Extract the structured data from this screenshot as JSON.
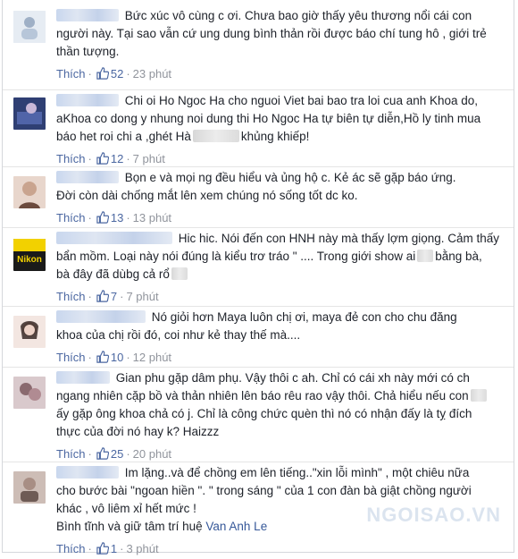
{
  "comments": [
    {
      "text_lines": [
        "Bức xúc vô cùng c ơi. Chưa bao giờ thấy yêu thương nổi cái con",
        "người này. Tại sao vẫn cứ ung dung bình thản rồi được báo chí tung hô , giới trẻ",
        "thần tượng."
      ],
      "like_label": "Thích",
      "likes": "52",
      "time": "23 phút",
      "avatar_color": "#b7c6d9"
    },
    {
      "text_lines": [
        "Chi oi Ho Ngoc Ha cho nguoi Viet bai bao tra loi cua anh Khoa do,",
        "aKhoa co dong y nhung noi dung thi Ho Ngoc Ha tự biên tự diễn,Hồ ly tinh mua",
        "báo het roi chi a ,ghét Hà",
        "khủng khiếp!"
      ],
      "like_label": "Thích",
      "likes": "12",
      "time": "7 phút",
      "avatar_color": "#3a4f8a"
    },
    {
      "text_lines": [
        "Bọn e và mọi ng đều hiểu và ủng hộ c. Kẻ ác sẽ gặp báo ứng.",
        "Đời còn dài chống mắt lên xem chúng nó sống tốt dc ko."
      ],
      "like_label": "Thích",
      "likes": "13",
      "time": "13 phút",
      "avatar_color": "#c9a48f"
    },
    {
      "text_lines": [
        "Hic hic. Nói đến con HNH này mà thấy lợm giọng. Cảm thấy",
        "bẩn mồm. Loại này nói đúng là kiểu trơ tráo \" .... Trong giới show ai",
        "bằng bà,",
        "bà đây đã dùbg cả rổ"
      ],
      "like_label": "Thích",
      "likes": "7",
      "time": "7 phút",
      "avatar_text": "Nikon",
      "avatar_color": "#f2d100"
    },
    {
      "text_lines": [
        "Nó giỏi hơn Maya luôn chị ơi, maya đẻ con cho chu đăng",
        "khoa của chị rồi đó, coi như kẻ thay thế mà...."
      ],
      "like_label": "Thích",
      "likes": "10",
      "time": "12 phút",
      "avatar_color": "#e3c3b6"
    },
    {
      "text_lines": [
        "Gian phu gặp dâm phụ. Vậy thôi c ah. Chỉ có cái xh này mới có ch",
        "ngang nhiên cặp bồ và thản nhiên lên báo rêu rao vậy thôi. Chả hiểu nếu con",
        "ấy gặp ông khoa chả có j. Chỉ là công chức quèn thì nó có nhận đấy là tỵ đích",
        "thực của đời nó hay k? Haizzz"
      ],
      "like_label": "Thích",
      "likes": "25",
      "time": "20 phút",
      "avatar_color": "#8a6a6f"
    },
    {
      "text_lines": [
        "Im lặng..và để chồng em lên tiếng..\"xin lỗi mình\" , một chiêu nữa",
        "cho bước bài \"ngoan hiền \". \" trong sáng \" của 1 con đàn bà giật chồng người",
        "khác , vô liêm xỉ hết mức !",
        "Bình tĩnh và giữ tâm trí huệ"
      ],
      "mention": "Van Anh Le",
      "like_label": "Thích",
      "likes": "1",
      "time": "3 phút",
      "avatar_color": "#a88e84"
    }
  ],
  "watermark": "NGOISAO.VN",
  "colors": {
    "link": "#365899",
    "meta": "#90949c",
    "like": "#4b67a1"
  },
  "icons": {
    "like": "thumbs-up-icon"
  }
}
